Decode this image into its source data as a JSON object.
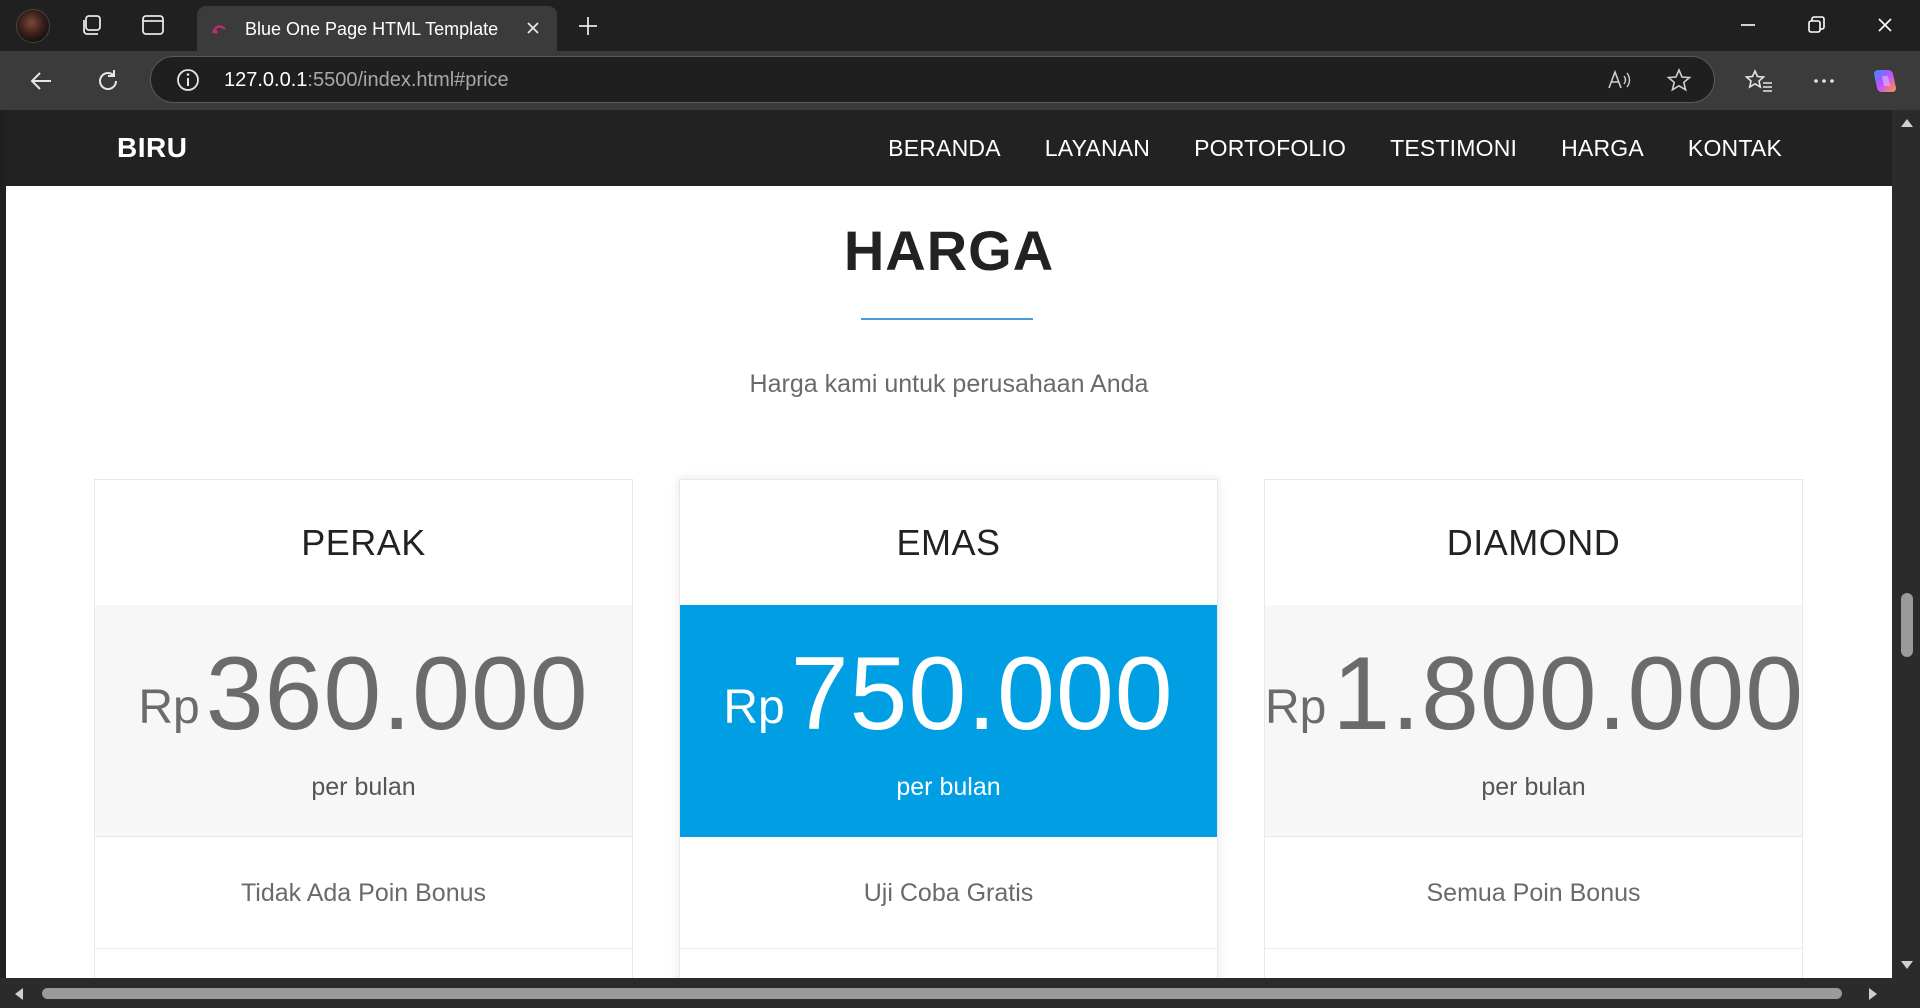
{
  "browser": {
    "tab_title": "Blue One Page HTML Template",
    "url_host": "127.0.0.1",
    "url_rest": ":5500/index.html#price"
  },
  "site": {
    "brand": "BIRU",
    "menu": [
      "BERANDA",
      "LAYANAN",
      "PORTOFOLIO",
      "TESTIMONI",
      "HARGA",
      "KONTAK"
    ]
  },
  "section": {
    "title": "HARGA",
    "subtitle": "Harga kami untuk perusahaan Anda"
  },
  "plans": [
    {
      "name": "PERAK",
      "currency": "Rp",
      "amount": "360.000",
      "period": "per bulan",
      "feature": "Tidak Ada Poin Bonus"
    },
    {
      "name": "EMAS",
      "currency": "Rp",
      "amount": "750.000",
      "period": "per bulan",
      "feature": "Uji Coba Gratis"
    },
    {
      "name": "DIAMOND",
      "currency": "Rp",
      "amount": "1.800.000",
      "period": "per bulan",
      "feature": "Semua Poin Bonus"
    }
  ],
  "colors": {
    "accent": "#009fe3",
    "nav_bg": "#222222",
    "chrome_bg": "#202020"
  },
  "icons": {
    "profile": "profile-avatar",
    "workspaces": "workspaces-icon",
    "tab_actions": "tab-actions-icon",
    "info": "site-info-icon",
    "read_aloud": "read-aloud-icon",
    "favorite": "favorite-star-icon",
    "favorites": "favorites-icon",
    "more": "more-icon",
    "copilot": "copilot-icon"
  }
}
